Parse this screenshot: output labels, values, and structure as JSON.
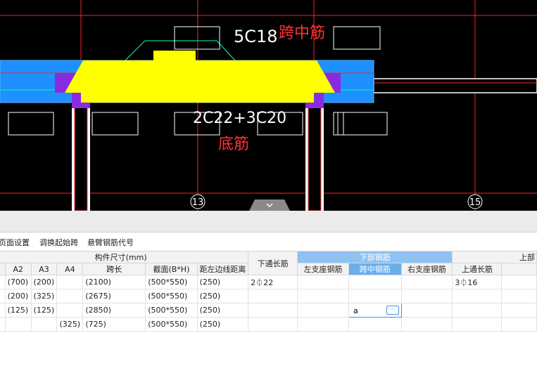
{
  "cad": {
    "top_rebar_label": "5C18",
    "top_annotation": "跨中筋",
    "bottom_rebar_label": "2C22+3C20",
    "bottom_annotation": "底筋",
    "axis_labels": [
      "13",
      "15"
    ],
    "collapse_icon": "chevron-down-icon",
    "colors": {
      "background": "#000000",
      "beam_fill": "#ffff00",
      "beam_band": "#1e90ff",
      "column": "#8a2be2",
      "annotation": "#ff3333",
      "axis": "#ff2020",
      "outline": "#00ff00"
    }
  },
  "toolbar": {
    "items": [
      "页面设置",
      "调换起始跨",
      "悬臂钢筋代号"
    ]
  },
  "grid": {
    "group_headers": {
      "dimensions": "构件尺寸(mm)",
      "bottom_steel": "下部钢筋",
      "top_steel": "上部"
    },
    "headers": {
      "a2": "A2",
      "a3": "A3",
      "a4": "A4",
      "span": "跨长",
      "section": "截面(B*H)",
      "edge_dist": "距左边线距离",
      "bottom_through": "下通长筋",
      "left_support": "左支座钢筋",
      "mid_span": "跨中钢筋",
      "right_support": "右支座钢筋",
      "top_through": "上通长筋"
    },
    "rows": [
      {
        "a2": "(700)",
        "a3": "(200)",
        "a4": "",
        "span": "(2100)",
        "section": "(500*550)",
        "edge": "(250)",
        "bottom_through": "2⏀22",
        "left": "",
        "mid": "",
        "right": "",
        "top_through": "3⏀16"
      },
      {
        "a2": "(200)",
        "a3": "(325)",
        "a4": "",
        "span": "(2675)",
        "section": "(500*550)",
        "edge": "(250)",
        "bottom_through": "",
        "left": "",
        "mid": "",
        "right": "",
        "top_through": ""
      },
      {
        "a2": "(125)",
        "a3": "(125)",
        "a4": "",
        "span": "(2850)",
        "section": "(500*550)",
        "edge": "(250)",
        "bottom_through": "",
        "left": "",
        "mid": "a",
        "right": "",
        "top_through": ""
      },
      {
        "a2": "",
        "a3": "",
        "a4": "(325)",
        "span": "(725)",
        "section": "(500*550)",
        "edge": "(250)",
        "bottom_through": "",
        "left": "",
        "mid": "",
        "right": "",
        "top_through": ""
      }
    ],
    "editing_icon": "ellipsis-icon",
    "editing_button": "···"
  }
}
